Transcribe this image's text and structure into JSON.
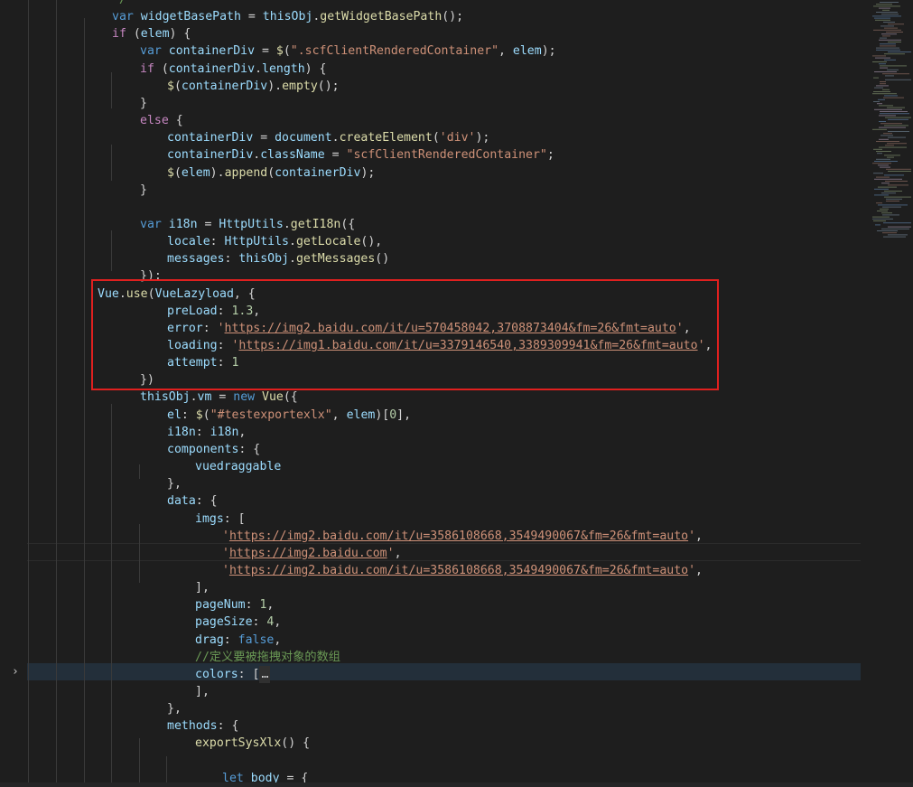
{
  "colors": {
    "background": "#1e1e1e",
    "keyword": "#569cd6",
    "control": "#c586c0",
    "variable": "#9cdcfe",
    "function": "#dcdcaa",
    "string": "#ce9178",
    "number": "#b5cea8",
    "comment": "#6a9955",
    "class": "#4ec9b0",
    "text": "#d4d4d4",
    "annotation": "#e0201f"
  },
  "editor": {
    "fold_icon": "chevron-right-icon",
    "lines": [
      [
        {
          "t": "*/",
          "c": "comment"
        }
      ],
      [
        {
          "t": "var ",
          "c": "keyword"
        },
        {
          "t": "widgetBasePath",
          "c": "variable"
        },
        {
          "t": " = ",
          "c": "text"
        },
        {
          "t": "thisObj",
          "c": "variable"
        },
        {
          "t": ".",
          "c": "text"
        },
        {
          "t": "getWidgetBasePath",
          "c": "function"
        },
        {
          "t": "();",
          "c": "text"
        }
      ],
      [
        {
          "t": "if",
          "c": "control"
        },
        {
          "t": " (",
          "c": "text"
        },
        {
          "t": "elem",
          "c": "variable"
        },
        {
          "t": ") {",
          "c": "text"
        }
      ],
      [
        {
          "t": "var ",
          "c": "keyword"
        },
        {
          "t": "containerDiv",
          "c": "variable"
        },
        {
          "t": " = ",
          "c": "text"
        },
        {
          "t": "$",
          "c": "function"
        },
        {
          "t": "(",
          "c": "text"
        },
        {
          "t": "\".scfClientRenderedContainer\"",
          "c": "string"
        },
        {
          "t": ", ",
          "c": "text"
        },
        {
          "t": "elem",
          "c": "variable"
        },
        {
          "t": ");",
          "c": "text"
        }
      ],
      [
        {
          "t": "if",
          "c": "control"
        },
        {
          "t": " (",
          "c": "text"
        },
        {
          "t": "containerDiv",
          "c": "variable"
        },
        {
          "t": ".",
          "c": "text"
        },
        {
          "t": "length",
          "c": "variable"
        },
        {
          "t": ") {",
          "c": "text"
        }
      ],
      [
        {
          "t": "$",
          "c": "function"
        },
        {
          "t": "(",
          "c": "text"
        },
        {
          "t": "containerDiv",
          "c": "variable"
        },
        {
          "t": ").",
          "c": "text"
        },
        {
          "t": "empty",
          "c": "function"
        },
        {
          "t": "();",
          "c": "text"
        }
      ],
      [
        {
          "t": "}",
          "c": "text"
        }
      ],
      [
        {
          "t": "else",
          "c": "control"
        },
        {
          "t": " {",
          "c": "text"
        }
      ],
      [
        {
          "t": "containerDiv",
          "c": "variable"
        },
        {
          "t": " = ",
          "c": "text"
        },
        {
          "t": "document",
          "c": "variable"
        },
        {
          "t": ".",
          "c": "text"
        },
        {
          "t": "createElement",
          "c": "function"
        },
        {
          "t": "(",
          "c": "text"
        },
        {
          "t": "'div'",
          "c": "string"
        },
        {
          "t": ");",
          "c": "text"
        }
      ],
      [
        {
          "t": "containerDiv",
          "c": "variable"
        },
        {
          "t": ".",
          "c": "text"
        },
        {
          "t": "className",
          "c": "variable"
        },
        {
          "t": " = ",
          "c": "text"
        },
        {
          "t": "\"scfClientRenderedContainer\"",
          "c": "string"
        },
        {
          "t": ";",
          "c": "text"
        }
      ],
      [
        {
          "t": "$",
          "c": "function"
        },
        {
          "t": "(",
          "c": "text"
        },
        {
          "t": "elem",
          "c": "variable"
        },
        {
          "t": ").",
          "c": "text"
        },
        {
          "t": "append",
          "c": "function"
        },
        {
          "t": "(",
          "c": "text"
        },
        {
          "t": "containerDiv",
          "c": "variable"
        },
        {
          "t": ");",
          "c": "text"
        }
      ],
      [
        {
          "t": "}",
          "c": "text"
        }
      ],
      [],
      [
        {
          "t": "var ",
          "c": "keyword"
        },
        {
          "t": "i18n",
          "c": "variable"
        },
        {
          "t": " = ",
          "c": "text"
        },
        {
          "t": "HttpUtils",
          "c": "variable"
        },
        {
          "t": ".",
          "c": "text"
        },
        {
          "t": "getI18n",
          "c": "function"
        },
        {
          "t": "({",
          "c": "text"
        }
      ],
      [
        {
          "t": "locale",
          "c": "variable"
        },
        {
          "t": ": ",
          "c": "text"
        },
        {
          "t": "HttpUtils",
          "c": "variable"
        },
        {
          "t": ".",
          "c": "text"
        },
        {
          "t": "getLocale",
          "c": "function"
        },
        {
          "t": "(),",
          "c": "text"
        }
      ],
      [
        {
          "t": "messages",
          "c": "variable"
        },
        {
          "t": ": ",
          "c": "text"
        },
        {
          "t": "thisObj",
          "c": "variable"
        },
        {
          "t": ".",
          "c": "text"
        },
        {
          "t": "getMessages",
          "c": "function"
        },
        {
          "t": "()",
          "c": "text"
        }
      ],
      [
        {
          "t": "});",
          "c": "text"
        }
      ],
      [
        {
          "t": "Vue",
          "c": "variable"
        },
        {
          "t": ".",
          "c": "text"
        },
        {
          "t": "use",
          "c": "function"
        },
        {
          "t": "(",
          "c": "text"
        },
        {
          "t": "VueLazyload",
          "c": "variable"
        },
        {
          "t": ", {",
          "c": "text"
        }
      ],
      [
        {
          "t": "preLoad",
          "c": "variable"
        },
        {
          "t": ": ",
          "c": "text"
        },
        {
          "t": "1.3",
          "c": "number"
        },
        {
          "t": ",",
          "c": "text"
        }
      ],
      [
        {
          "t": "error",
          "c": "variable"
        },
        {
          "t": ": ",
          "c": "text"
        },
        {
          "t": "'",
          "c": "string"
        },
        {
          "t": "https://img2.baidu.com/it/u=570458042,3708873404&fm=26&fmt=auto",
          "c": "string",
          "u": true
        },
        {
          "t": "'",
          "c": "string"
        },
        {
          "t": ",",
          "c": "text"
        }
      ],
      [
        {
          "t": "loading",
          "c": "variable"
        },
        {
          "t": ": ",
          "c": "text"
        },
        {
          "t": "'",
          "c": "string"
        },
        {
          "t": "https://img1.baidu.com/it/u=3379146540,3389309941&fm=26&fmt=auto",
          "c": "string",
          "u": true
        },
        {
          "t": "'",
          "c": "string"
        },
        {
          "t": ",",
          "c": "text"
        }
      ],
      [
        {
          "t": "attempt",
          "c": "variable"
        },
        {
          "t": ": ",
          "c": "text"
        },
        {
          "t": "1",
          "c": "number"
        }
      ],
      [
        {
          "t": "})",
          "c": "text"
        }
      ],
      [
        {
          "t": "thisObj",
          "c": "variable"
        },
        {
          "t": ".",
          "c": "text"
        },
        {
          "t": "vm",
          "c": "variable"
        },
        {
          "t": " = ",
          "c": "text"
        },
        {
          "t": "new ",
          "c": "keyword"
        },
        {
          "t": "Vue",
          "c": "function"
        },
        {
          "t": "({",
          "c": "text"
        }
      ],
      [
        {
          "t": "el",
          "c": "variable"
        },
        {
          "t": ": ",
          "c": "text"
        },
        {
          "t": "$",
          "c": "function"
        },
        {
          "t": "(",
          "c": "text"
        },
        {
          "t": "\"#testexportexlx\"",
          "c": "string"
        },
        {
          "t": ", ",
          "c": "text"
        },
        {
          "t": "elem",
          "c": "variable"
        },
        {
          "t": ")[",
          "c": "text"
        },
        {
          "t": "0",
          "c": "number"
        },
        {
          "t": "],",
          "c": "text"
        }
      ],
      [
        {
          "t": "i18n",
          "c": "variable"
        },
        {
          "t": ": ",
          "c": "text"
        },
        {
          "t": "i18n",
          "c": "variable"
        },
        {
          "t": ",",
          "c": "text"
        }
      ],
      [
        {
          "t": "components",
          "c": "variable"
        },
        {
          "t": ": {",
          "c": "text"
        }
      ],
      [
        {
          "t": "vuedraggable",
          "c": "variable"
        }
      ],
      [
        {
          "t": "},",
          "c": "text"
        }
      ],
      [
        {
          "t": "data",
          "c": "variable"
        },
        {
          "t": ": {",
          "c": "text"
        }
      ],
      [
        {
          "t": "imgs",
          "c": "variable"
        },
        {
          "t": ": [",
          "c": "text"
        }
      ],
      [
        {
          "t": "'",
          "c": "string"
        },
        {
          "t": "https://img2.baidu.com/it/u=3586108668,3549490067&fm=26&fmt=auto",
          "c": "string",
          "u": true
        },
        {
          "t": "'",
          "c": "string"
        },
        {
          "t": ",",
          "c": "text"
        }
      ],
      [
        {
          "t": "'",
          "c": "string"
        },
        {
          "t": "https://img2.baidu.com",
          "c": "string",
          "u": true
        },
        {
          "t": "'",
          "c": "string"
        },
        {
          "t": ",",
          "c": "text"
        }
      ],
      [
        {
          "t": "'",
          "c": "string"
        },
        {
          "t": "https://img2.baidu.com/it/u=3586108668,3549490067&fm=26&fmt=auto",
          "c": "string",
          "u": true
        },
        {
          "t": "'",
          "c": "string"
        },
        {
          "t": ",",
          "c": "text"
        }
      ],
      [
        {
          "t": "],",
          "c": "text"
        }
      ],
      [
        {
          "t": "pageNum",
          "c": "variable"
        },
        {
          "t": ": ",
          "c": "text"
        },
        {
          "t": "1",
          "c": "number"
        },
        {
          "t": ",",
          "c": "text"
        }
      ],
      [
        {
          "t": "pageSize",
          "c": "variable"
        },
        {
          "t": ": ",
          "c": "text"
        },
        {
          "t": "4",
          "c": "number"
        },
        {
          "t": ",",
          "c": "text"
        }
      ],
      [
        {
          "t": "drag",
          "c": "variable"
        },
        {
          "t": ": ",
          "c": "text"
        },
        {
          "t": "false",
          "c": "keyword"
        },
        {
          "t": ",",
          "c": "text"
        }
      ],
      [
        {
          "t": "//定义要被拖拽对象的数组",
          "c": "comment"
        }
      ],
      [
        {
          "t": "colors",
          "c": "variable"
        },
        {
          "t": ": [",
          "c": "text"
        },
        {
          "t": "…",
          "c": "text",
          "box": true
        }
      ],
      [
        {
          "t": "],",
          "c": "text"
        }
      ],
      [
        {
          "t": "},",
          "c": "text"
        }
      ],
      [
        {
          "t": "methods",
          "c": "variable"
        },
        {
          "t": ": {",
          "c": "text"
        }
      ],
      [
        {
          "t": "exportSysXlx",
          "c": "function"
        },
        {
          "t": "() {",
          "c": "text"
        }
      ],
      [],
      [
        {
          "t": "let ",
          "c": "keyword"
        },
        {
          "t": "body",
          "c": "variable"
        },
        {
          "t": " = {",
          "c": "text"
        }
      ]
    ]
  }
}
